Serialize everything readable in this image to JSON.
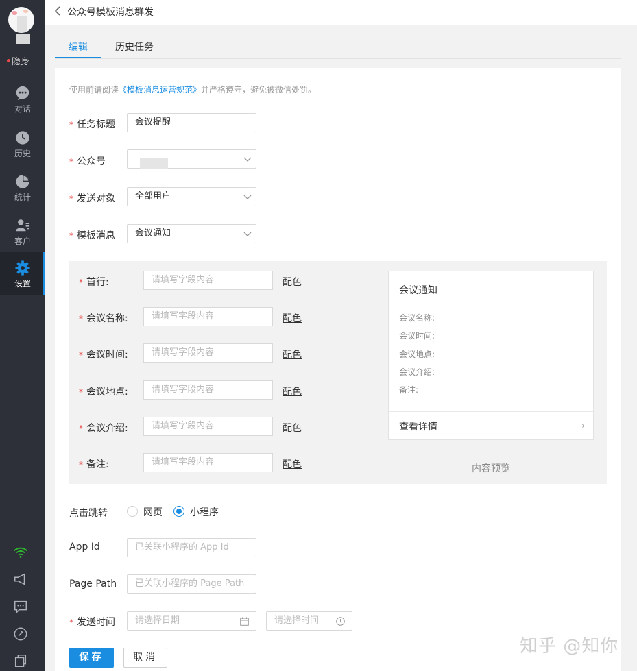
{
  "sidebar": {
    "status": "隐身",
    "items": [
      {
        "label": "对话",
        "icon": "chat-bubble-icon"
      },
      {
        "label": "历史",
        "icon": "clock-icon"
      },
      {
        "label": "统计",
        "icon": "pie-chart-icon"
      },
      {
        "label": "客户",
        "icon": "customer-icon"
      },
      {
        "label": "设置",
        "icon": "gear-icon"
      }
    ],
    "bottom_icons": [
      "wifi-icon",
      "megaphone-icon",
      "message-box-icon",
      "link-icon",
      "copy-icon"
    ]
  },
  "header": {
    "title": "公众号模板消息群发"
  },
  "tabs": [
    {
      "label": "编辑"
    },
    {
      "label": "历史任务"
    }
  ],
  "notice": {
    "prefix": "使用前请阅读",
    "link": "《模板消息运营规范》",
    "suffix": "并严格遵守，避免被微信处罚。"
  },
  "form": {
    "task_title": {
      "label": "任务标题",
      "value": "会议提醒"
    },
    "account": {
      "label": "公众号",
      "value": ""
    },
    "target": {
      "label": "发送对象",
      "value": "全部用户"
    },
    "template": {
      "label": "模板消息",
      "value": "会议通知"
    }
  },
  "template_fields": [
    {
      "label": "首行:",
      "placeholder": "请填写字段内容",
      "color_label": "配色"
    },
    {
      "label": "会议名称:",
      "placeholder": "请填写字段内容",
      "color_label": "配色"
    },
    {
      "label": "会议时间:",
      "placeholder": "请填写字段内容",
      "color_label": "配色"
    },
    {
      "label": "会议地点:",
      "placeholder": "请填写字段内容",
      "color_label": "配色"
    },
    {
      "label": "会议介绍:",
      "placeholder": "请填写字段内容",
      "color_label": "配色"
    },
    {
      "label": "备注:",
      "placeholder": "请填写字段内容",
      "color_label": "配色"
    }
  ],
  "preview": {
    "title": "会议通知",
    "fields": [
      "会议名称:",
      "会议时间:",
      "会议地点:",
      "会议介绍:",
      "备注:"
    ],
    "detail": "查看详情",
    "chevron": "›",
    "caption": "内容预览"
  },
  "jump": {
    "label": "点击跳转",
    "options": [
      "网页",
      "小程序"
    ],
    "selected": "小程序"
  },
  "app_id": {
    "label": "App Id",
    "placeholder": "已关联小程序的 App Id"
  },
  "page_path": {
    "label": "Page Path",
    "placeholder": "已关联小程序的 Page Path"
  },
  "send_time": {
    "label": "发送时间",
    "date_placeholder": "请选择日期",
    "time_placeholder": "请选择时间"
  },
  "buttons": {
    "save": "保存",
    "cancel": "取消"
  },
  "watermark": "知乎 @知你",
  "colors": {
    "accent": "#1a8de0",
    "sidebar": "#2d3038",
    "required": "#e94b4b"
  }
}
